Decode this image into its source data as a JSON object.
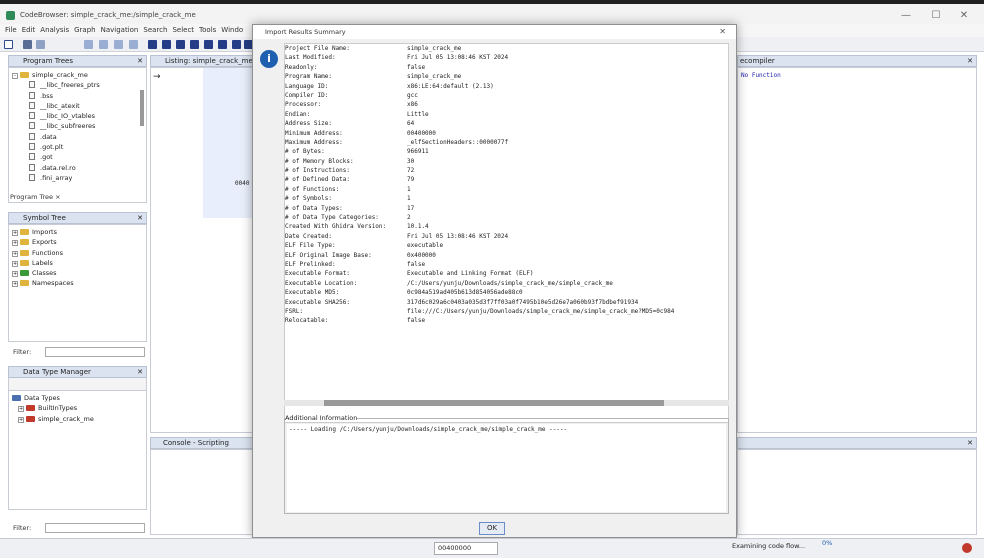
{
  "window": {
    "title": "CodeBrowser: simple_crack_me:/simple_crack_me",
    "minimize": "—",
    "maximize": "☐",
    "close": "✕"
  },
  "menu": [
    "File",
    "Edit",
    "Analysis",
    "Graph",
    "Navigation",
    "Search",
    "Select",
    "Tools",
    "Windo"
  ],
  "program_trees": {
    "title": "Program Trees",
    "root": "simple_crack_me",
    "items": [
      "__libc_freeres_ptrs",
      ".bss",
      "__libc_atexit",
      "__libc_IO_vtables",
      "__libc_subfreeres",
      ".data",
      ".got.plt",
      ".got",
      ".data.rel.ro",
      ".fini_array"
    ],
    "tab": "Program Tree ×"
  },
  "symbol_tree": {
    "title": "Symbol Tree",
    "items": [
      "Imports",
      "Exports",
      "Functions",
      "Labels",
      "Classes",
      "Namespaces"
    ],
    "filter_label": "Filter:"
  },
  "data_type_manager": {
    "title": "Data Type Manager",
    "root": "Data Types",
    "items": [
      "BuiltInTypes",
      "simple_crack_me"
    ],
    "filter_label": "Filter:"
  },
  "listing": {
    "title": "Listing:  simple_crack_me",
    "addr": "0040"
  },
  "console": {
    "title": "Console - Scripting"
  },
  "decompiler": {
    "title": "ecompiler",
    "text": "No Function"
  },
  "dialog": {
    "title": "Import Results Summary",
    "rows": [
      {
        "k": "Project File Name:",
        "v": "simple_crack_me"
      },
      {
        "k": "Last Modified:",
        "v": "Fri Jul 05 13:08:46 KST 2024"
      },
      {
        "k": "Readonly:",
        "v": "false"
      },
      {
        "k": "Program Name:",
        "v": "simple_crack_me"
      },
      {
        "k": "Language ID:",
        "v": "x86:LE:64:default (2.13)"
      },
      {
        "k": "Compiler ID:",
        "v": "gcc"
      },
      {
        "k": "Processor:",
        "v": "x86"
      },
      {
        "k": "Endian:",
        "v": "Little"
      },
      {
        "k": "Address Size:",
        "v": "64"
      },
      {
        "k": "Minimum Address:",
        "v": "00400000"
      },
      {
        "k": "Maximum Address:",
        "v": "_elfSectionHeaders::0000077f"
      },
      {
        "k": "# of Bytes:",
        "v": "966911"
      },
      {
        "k": "# of Memory Blocks:",
        "v": "30"
      },
      {
        "k": "# of Instructions:",
        "v": "72"
      },
      {
        "k": "# of Defined Data:",
        "v": "79"
      },
      {
        "k": "# of Functions:",
        "v": "1"
      },
      {
        "k": "# of Symbols:",
        "v": "1"
      },
      {
        "k": "# of Data Types:",
        "v": "17"
      },
      {
        "k": "# of Data Type Categories:",
        "v": "2"
      },
      {
        "k": "Created With Ghidra Version:",
        "v": "10.1.4"
      },
      {
        "k": "Date Created:",
        "v": "Fri Jul 05 13:08:46 KST 2024"
      },
      {
        "k": "ELF File Type:",
        "v": "executable"
      },
      {
        "k": "ELF Original Image Base:",
        "v": "0x400000"
      },
      {
        "k": "ELF Prelinked:",
        "v": "false"
      },
      {
        "k": "Executable Format:",
        "v": "Executable and Linking Format (ELF)"
      },
      {
        "k": "Executable Location:",
        "v": "/C:/Users/yunju/Downloads/simple_crack_me/simple_crack_me"
      },
      {
        "k": "Executable MD5:",
        "v": "0c984a519ad405b613d854056ade88c0"
      },
      {
        "k": "Executable SHA256:",
        "v": "317d6c029a6c0403a035d3f7ff03a0f7495b10e5d26e7a060b93f7bdbef91934"
      },
      {
        "k": "FSRL:",
        "v": "file:///C:/Users/yunju/Downloads/simple_crack_me/simple_crack_me?MD5=0c984"
      },
      {
        "k": "Relocatable:",
        "v": "false"
      }
    ],
    "additional_label": "Additional Information",
    "additional_text": "----- Loading /C:/Users/yunju/Downloads/simple_crack_me/simple_crack_me -----",
    "ok": "OK"
  },
  "status": {
    "address": "00400000",
    "progress": "0%",
    "task": "Examining code flow..."
  }
}
